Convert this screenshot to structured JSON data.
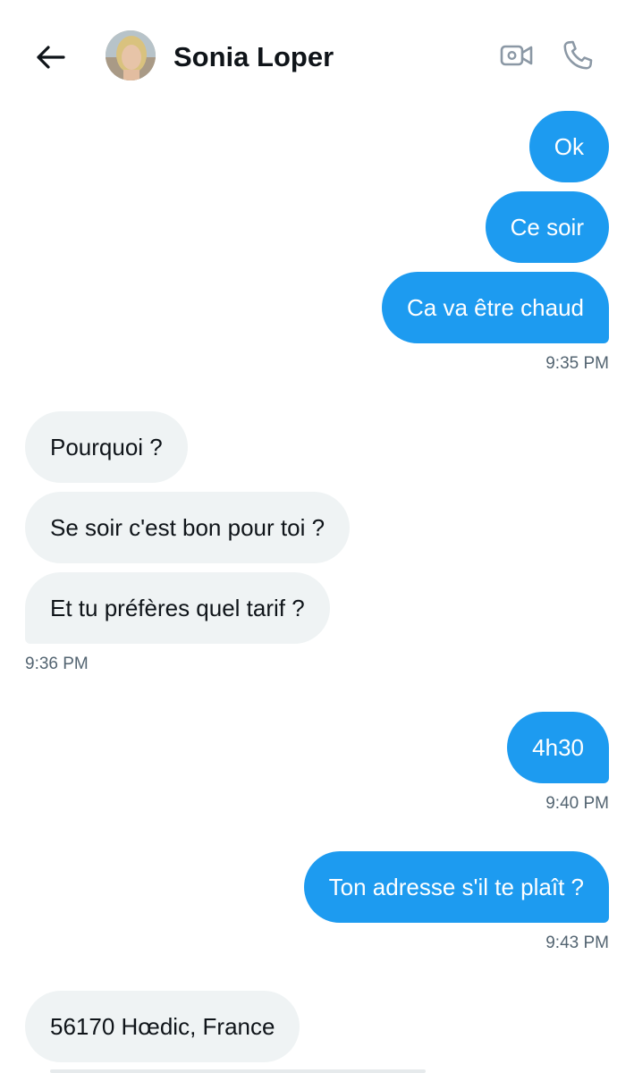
{
  "header": {
    "back_icon": "arrow-left-icon",
    "contact_name": "Sonia Loper",
    "video_icon": "video-camera-icon",
    "call_icon": "phone-icon"
  },
  "colors": {
    "outgoing_bubble": "#1d9bf0",
    "incoming_bubble": "#eff3f4",
    "timestamp": "#536471",
    "text": "#0f1419"
  },
  "messages": [
    {
      "direction": "out",
      "text": "Ok"
    },
    {
      "direction": "out",
      "text": "Ce soir"
    },
    {
      "direction": "out",
      "text": "Ca va être chaud",
      "time": "9:35 PM"
    },
    {
      "direction": "in",
      "text": "Pourquoi ?"
    },
    {
      "direction": "in",
      "text": "Se soir c'est bon pour toi ?"
    },
    {
      "direction": "in",
      "text": "Et tu préfères quel tarif ?",
      "time": "9:36 PM"
    },
    {
      "direction": "out",
      "text": "4h30",
      "time": "9:40 PM"
    },
    {
      "direction": "out",
      "text": "Ton adresse s'il te plaît ?",
      "time": "9:43 PM"
    },
    {
      "direction": "in",
      "text": "56170 Hœdic, France"
    }
  ]
}
